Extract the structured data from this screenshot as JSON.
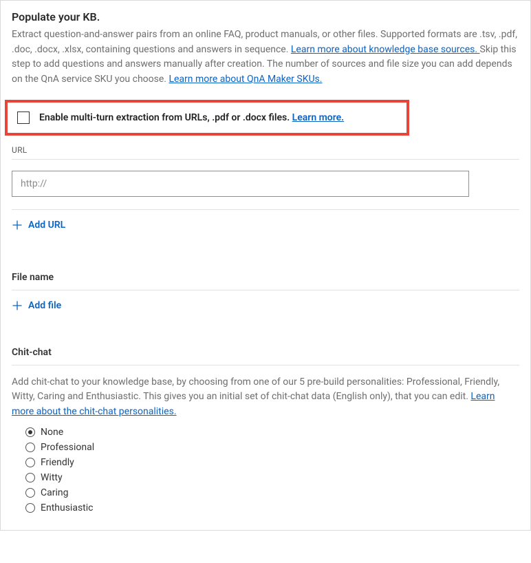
{
  "header": {
    "title": "Populate your KB.",
    "intro_part1": "Extract question-and-answer pairs from an online FAQ, product manuals, or other files. Supported formats are .tsv, .pdf, .doc, .docx, .xlsx, containing questions and answers in sequence. ",
    "link1": "Learn more about knowledge base sources. ",
    "intro_part2": "Skip this step to add questions and answers manually after creation. The number of sources and file size you can add depends on the QnA service SKU you choose. ",
    "link2": "Learn more about QnA Maker SKUs."
  },
  "multiturn": {
    "label_prefix": "Enable multi-turn extraction from URLs, .pdf or .docx files. ",
    "learn_more": "Learn more."
  },
  "url_section": {
    "label": "URL",
    "placeholder": "http://",
    "value": "",
    "add_label": "Add URL"
  },
  "file_section": {
    "label": "File name",
    "add_label": "Add file"
  },
  "chitchat": {
    "label": "Chit-chat",
    "desc_prefix": "Add chit-chat to your knowledge base, by choosing from one of our 5 pre-build personalities: Professional, Friendly, Witty, Caring and Enthusiastic. This gives you an initial set of chit-chat data (English only), that you can edit. ",
    "learn_more": "Learn more about the chit-chat personalities.",
    "options": [
      {
        "label": "None",
        "checked": true
      },
      {
        "label": "Professional",
        "checked": false
      },
      {
        "label": "Friendly",
        "checked": false
      },
      {
        "label": "Witty",
        "checked": false
      },
      {
        "label": "Caring",
        "checked": false
      },
      {
        "label": "Enthusiastic",
        "checked": false
      }
    ]
  }
}
